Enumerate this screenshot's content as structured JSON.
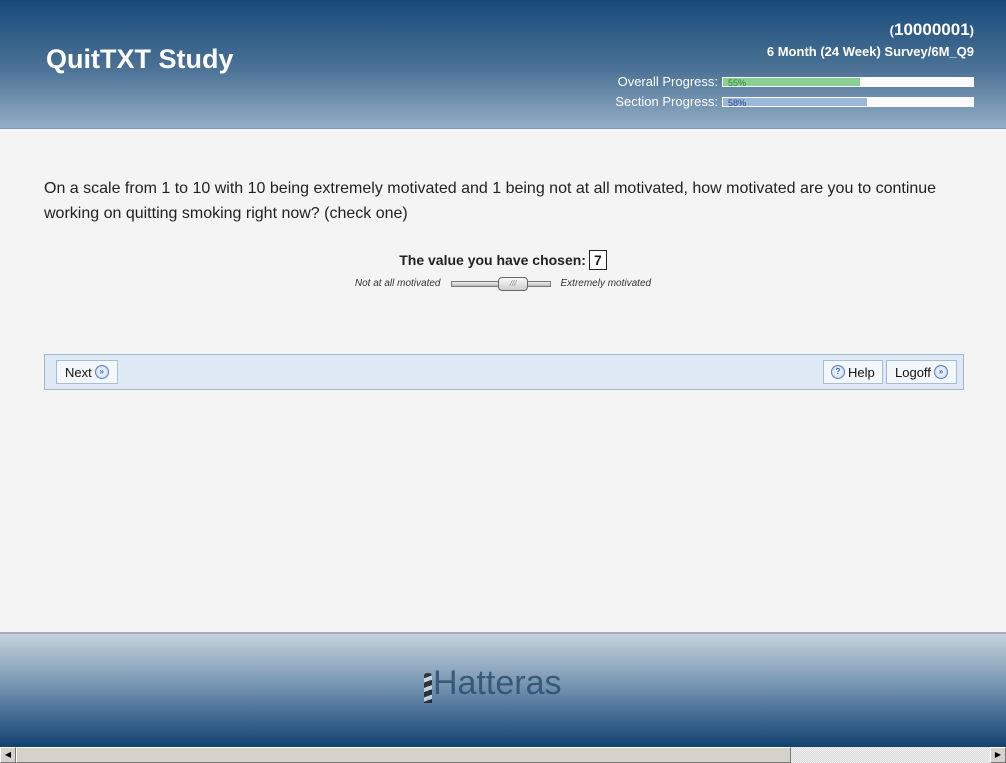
{
  "header": {
    "title": "QuitTXT Study",
    "participant_id": "10000001",
    "survey": "6 Month (24 Week) Survey/6M_Q9",
    "overall_label": "Overall Progress:",
    "overall_percent": 55,
    "overall_text": "55%",
    "section_label": "Section Progress:",
    "section_percent": 58,
    "section_text": "58%"
  },
  "question": "On a scale from 1 to 10 with 10 being extremely motivated and 1 being not at all motivated, how motivated are you to continue working on quitting smoking right now? (check one)",
  "slider": {
    "chosen_label": "The value you have chosen:",
    "value": "7",
    "min": 1,
    "max": 10,
    "min_label": "Not at all motivated",
    "max_label": "Extremely motivated"
  },
  "nav": {
    "next": "Next",
    "help": "Help",
    "logoff": "Logoff"
  },
  "footer": {
    "logo": "Hatteras"
  },
  "colors": {
    "overall_fill": "#8ccf93",
    "section_fill": "#9bb6d6"
  }
}
